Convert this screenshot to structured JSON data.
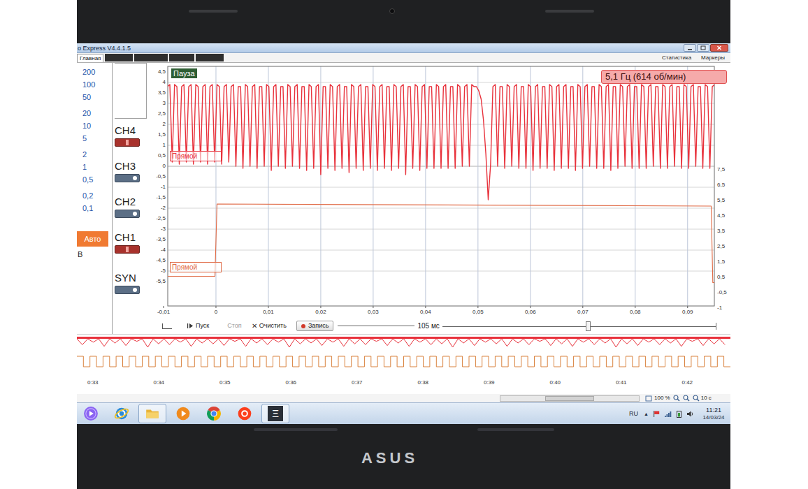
{
  "window": {
    "title": "o Express V4.4.1.5"
  },
  "menu": {
    "tabs": [
      {
        "label": "Главная",
        "selected": true
      }
    ],
    "right": [
      "Статистика",
      "Маркеры"
    ]
  },
  "scale": {
    "groups": [
      [
        "200",
        "100",
        "50"
      ],
      [
        "20",
        "10",
        "5"
      ],
      [
        "2",
        "1",
        "0,5"
      ],
      [
        "0,2",
        "0,1"
      ]
    ],
    "auto": "Авто",
    "unit": "В"
  },
  "channels": [
    {
      "name": "CH4",
      "on": true
    },
    {
      "name": "CH3",
      "on": false
    },
    {
      "name": "CH2",
      "on": false
    },
    {
      "name": "CH1",
      "on": true
    }
  ],
  "sync": {
    "name": "SYN",
    "on": false
  },
  "chart": {
    "status": "Пауза",
    "frequency": "5,1 Гц (614 об/мин)",
    "y_ticks": [
      "4,5",
      "4",
      "3,5",
      "3",
      "2,5",
      "2",
      "1,5",
      "1",
      "0,5",
      "0",
      "-0,5",
      "-1",
      "-1,5",
      "-2",
      "-2,5",
      "-3",
      "-3,5",
      "-4",
      "-4,5",
      "-5",
      "-5,5"
    ],
    "y_ticks_right": [
      "7,5",
      "6,5",
      "5,5",
      "4,5",
      "3,5",
      "2,5",
      "1,5",
      "0,5",
      "-0,5",
      "-1"
    ],
    "x_ticks": [
      "-0,01",
      "0",
      "0,01",
      "0,02",
      "0,03",
      "0,04",
      "0,05",
      "0,06",
      "0,07",
      "0,08",
      "0,09"
    ],
    "series": [
      {
        "name": "CH4",
        "label": "Прямой",
        "color": "#e8323c",
        "start": -0.0106,
        "step": 0.00045,
        "values": [
          3.8,
          3.9,
          0.2,
          3.8,
          3.9,
          0.2,
          3.9,
          3.8,
          0.1,
          3.8,
          3.9,
          0.2,
          3.8,
          3.9,
          0.1,
          3.9,
          3.8,
          0.2,
          3.8,
          3.9,
          0.1,
          3.8,
          3.9,
          0.2,
          3.9,
          3.8,
          0.1,
          3.8,
          3.9,
          0.2,
          3.8,
          3.9,
          0.0,
          3.8,
          3.8,
          -0.1,
          3.9,
          3.8,
          0.0,
          3.8,
          3.9,
          -0.1,
          3.8,
          3.8,
          0.0,
          3.9,
          3.8,
          -0.2,
          3.8,
          3.9,
          0.0,
          3.8,
          3.8,
          -0.1,
          3.9,
          3.8,
          0.0,
          3.8,
          3.9,
          -0.1,
          3.8,
          3.8,
          -0.2,
          3.9,
          3.8,
          -0.1,
          3.8,
          3.9,
          -0.4,
          3.8,
          3.8,
          -0.1,
          3.9,
          3.8,
          -0.2,
          3.8,
          3.9,
          -0.1,
          3.8,
          3.8,
          -0.3,
          3.9,
          3.8,
          -0.1,
          3.8,
          3.9,
          -0.2,
          3.8,
          3.8,
          -0.1,
          3.9,
          3.8,
          -0.2,
          3.8,
          3.9,
          -0.1,
          3.8,
          3.8,
          -0.2,
          3.9,
          3.8,
          -0.1,
          3.8,
          3.9,
          -0.4,
          3.8,
          3.8,
          -0.1,
          3.9,
          3.8,
          -0.2,
          3.8,
          3.9,
          -0.1,
          3.8,
          3.8,
          -0.1,
          3.9,
          3.8,
          -0.1,
          3.8,
          3.9,
          -0.1,
          3.8,
          3.8,
          -0.1,
          3.9,
          3.8,
          0.0,
          3.8,
          3.9,
          0.0,
          3.9,
          3.8,
          3.8,
          3.6,
          3.2,
          2.2,
          0.6,
          -1.6,
          0.1,
          3.8,
          3.9,
          0.0,
          3.8,
          3.8,
          -0.1,
          3.9,
          3.8,
          0.0,
          3.8,
          3.9,
          -0.1,
          3.8,
          3.8,
          -0.1,
          3.9,
          3.8,
          -0.2,
          3.8,
          3.9,
          -0.1,
          3.8,
          3.8,
          -0.1,
          3.9,
          3.8,
          -0.2,
          3.8,
          3.9,
          -0.1,
          3.8,
          3.9,
          -0.1,
          3.8,
          3.8,
          -0.2,
          3.9,
          3.8,
          -0.1,
          3.8,
          3.9,
          0.0,
          3.8,
          3.8,
          -0.1,
          3.9,
          3.8,
          -0.1,
          3.8,
          3.9,
          -0.2,
          3.8,
          3.8,
          -0.1,
          3.9,
          3.8,
          0.0,
          3.8,
          3.9,
          -0.1,
          3.8,
          3.8,
          -0.1,
          3.9,
          3.8,
          -0.1,
          3.8,
          3.9,
          0.0,
          3.8,
          3.8,
          -0.1,
          3.9,
          3.8,
          -0.1,
          3.8,
          3.9,
          0.0,
          3.8,
          3.8,
          -0.1,
          3.9,
          3.8,
          -0.1,
          3.8,
          3.9,
          0.0,
          3.8,
          3.8,
          -0.1,
          3.9,
          3.8,
          -0.1,
          3.8,
          3.9,
          0.0
        ]
      },
      {
        "name": "CH1",
        "label": "Прямой",
        "color": "#e06a45",
        "times": [
          -0.0095,
          -0.0002,
          0.0002,
          0.0945,
          0.0948,
          0.0977
        ],
        "values": [
          -5.25,
          -5.25,
          -1.8,
          -1.9,
          -5.55,
          -5.55
        ]
      }
    ]
  },
  "controls": {
    "start": "Пуск",
    "stop": "Стоп",
    "stop_disabled": true,
    "clear_icon": "✕",
    "clear": "Очистить",
    "record": "Запись",
    "window": "105 мс",
    "slider": {
      "level": 0.53
    }
  },
  "overview": {
    "times": [
      "0:33",
      "0:34",
      "0:35",
      "0:36",
      "0:37",
      "0:38",
      "0:39",
      "0:40",
      "0:41",
      "0:42"
    ],
    "noise": {
      "color": "#e8323c",
      "values": [
        0.7,
        0.4,
        0.9,
        0.5,
        0.8,
        0.3,
        1,
        0.6,
        0.7,
        0.4,
        0.9,
        0.5,
        0.6,
        0.8,
        0.3,
        0.9,
        0.5,
        0.7,
        0.4,
        1,
        0.6,
        0.5,
        0.8,
        0.4,
        0.9,
        0.6,
        0.7,
        0.3,
        0.8,
        0.5,
        0.9,
        0.4,
        0.7,
        0.6,
        1,
        0.5,
        0.8,
        0.4,
        0.6,
        0.9,
        0.5,
        0.7,
        0.3,
        0.8,
        0.6,
        0.9,
        0.4,
        0.7,
        0.5,
        1,
        0.6,
        0.8,
        0.4,
        0.7,
        0.5,
        0.9,
        0.3,
        0.8,
        0.6,
        0.7
      ]
    },
    "pulses": {
      "color": "#d9823e",
      "values": [
        1,
        0,
        1,
        0,
        1,
        0,
        1,
        0,
        1,
        0,
        1,
        0,
        1,
        0,
        1,
        0,
        1,
        0,
        1,
        0,
        1,
        0,
        1,
        0,
        1,
        0,
        1,
        0,
        1,
        0,
        1,
        0,
        1,
        0,
        1,
        0,
        1,
        0,
        1,
        0,
        1,
        0,
        1,
        0,
        1,
        0,
        1,
        0,
        1,
        0,
        1,
        0,
        1,
        0,
        1,
        0,
        1,
        0,
        1,
        0,
        1,
        0,
        1,
        0,
        1,
        0,
        1,
        0,
        1,
        0,
        1,
        0,
        1,
        0,
        1,
        0,
        1,
        0,
        1,
        0,
        1,
        0,
        1,
        0,
        1,
        0,
        1,
        0,
        1,
        0,
        1,
        0,
        1,
        0,
        1,
        0,
        1,
        0,
        1,
        0
      ]
    }
  },
  "zoom": {
    "value": "100 %",
    "span": "10 с"
  },
  "taskbar": {
    "apps": [
      {
        "kind": "alice",
        "highlighted": false
      },
      {
        "kind": "ie",
        "highlighted": false
      },
      {
        "kind": "explorer",
        "highlighted": true
      },
      {
        "kind": "media",
        "highlighted": false
      },
      {
        "kind": "chrome",
        "highlighted": false
      },
      {
        "kind": "yandex",
        "highlighted": false
      },
      {
        "kind": "app",
        "label": "Ξ",
        "highlighted": true
      }
    ],
    "lang": "RU",
    "expand": "▲",
    "time": "11:21",
    "date": "14/03/24"
  },
  "laptop": {
    "brand": "ASUS"
  }
}
